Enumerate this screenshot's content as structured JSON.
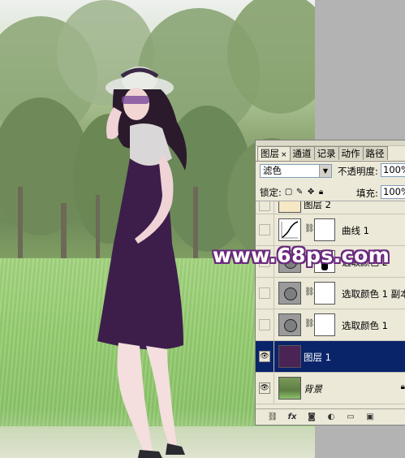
{
  "watermark": {
    "text": "www.68ps.com"
  },
  "layers_panel": {
    "tabs": [
      {
        "label": "图层",
        "close": "×",
        "active": true
      },
      {
        "label": "通道",
        "active": false
      },
      {
        "label": "记录",
        "active": false
      },
      {
        "label": "动作",
        "active": false
      },
      {
        "label": "路径",
        "active": false
      }
    ],
    "blend_mode": "滤色",
    "opacity_label": "不透明度:",
    "opacity_value": "100%",
    "lock_label": "锁定:",
    "fill_label": "填充:",
    "fill_value": "100%",
    "layers": [
      {
        "name": "图层 2",
        "type": "partial",
        "visible": false,
        "selected": false
      },
      {
        "name": "曲线 1",
        "type": "curves",
        "visible": false,
        "selected": false
      },
      {
        "name": "选取颜色 2",
        "type": "adjustment",
        "visible": false,
        "selected": false
      },
      {
        "name": "选取颜色 1 副本",
        "type": "adjustment",
        "visible": false,
        "selected": false
      },
      {
        "name": "选取颜色 1",
        "type": "adjustment",
        "visible": false,
        "selected": false
      },
      {
        "name": "图层 1",
        "type": "fill",
        "visible": true,
        "selected": true,
        "color": "#4a2455"
      },
      {
        "name": "背景",
        "type": "background",
        "visible": true,
        "selected": false
      }
    ],
    "colors": {
      "selected_row": "#0a246a",
      "panel_bg": "#ece9d8"
    }
  }
}
